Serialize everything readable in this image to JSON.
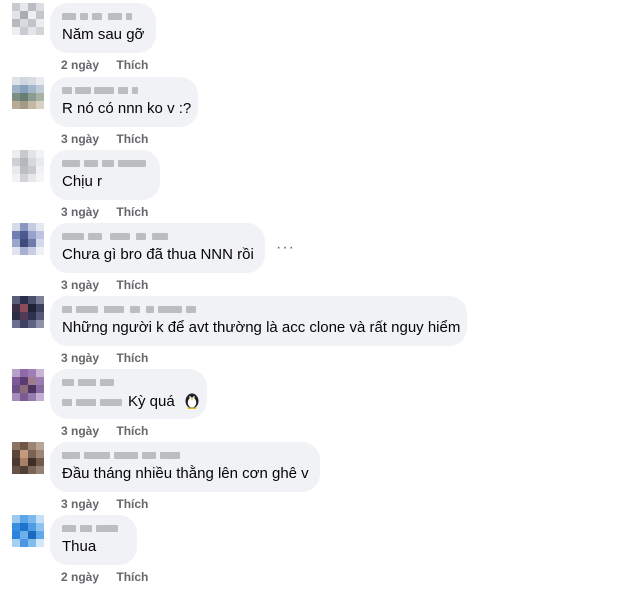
{
  "comments": [
    {
      "text": "Năm sau gỡ",
      "time": "2 ngày",
      "like": "Thích"
    },
    {
      "text": "R nó có nnn ko v :?",
      "time": "3 ngày",
      "like": "Thích"
    },
    {
      "text": "Chịu r",
      "time": "3 ngày",
      "like": "Thích"
    },
    {
      "text": "Chưa gì bro đã thua NNN rồi",
      "time": "3 ngày",
      "like": "Thích",
      "more": "···"
    },
    {
      "text": "Những người k để avt thường là acc clone và rất nguy hiểm",
      "time": "3 ngày",
      "like": "Thích"
    },
    {
      "text": "Kỳ quá",
      "time": "3 ngày",
      "like": "Thích",
      "emoji": "penguin-emoji"
    },
    {
      "text": "Đầu tháng nhiều thằng lên cơn ghê v",
      "time": "3 ngày",
      "like": "Thích"
    },
    {
      "text": "Thua",
      "time": "2 ngày",
      "like": "Thích"
    }
  ],
  "colors": {
    "bubble": "#f0f2f5",
    "meta": "#65676b",
    "text": "#050505"
  },
  "icons": {
    "more": "more-options-icon",
    "emoji": "penguin-emoji"
  }
}
